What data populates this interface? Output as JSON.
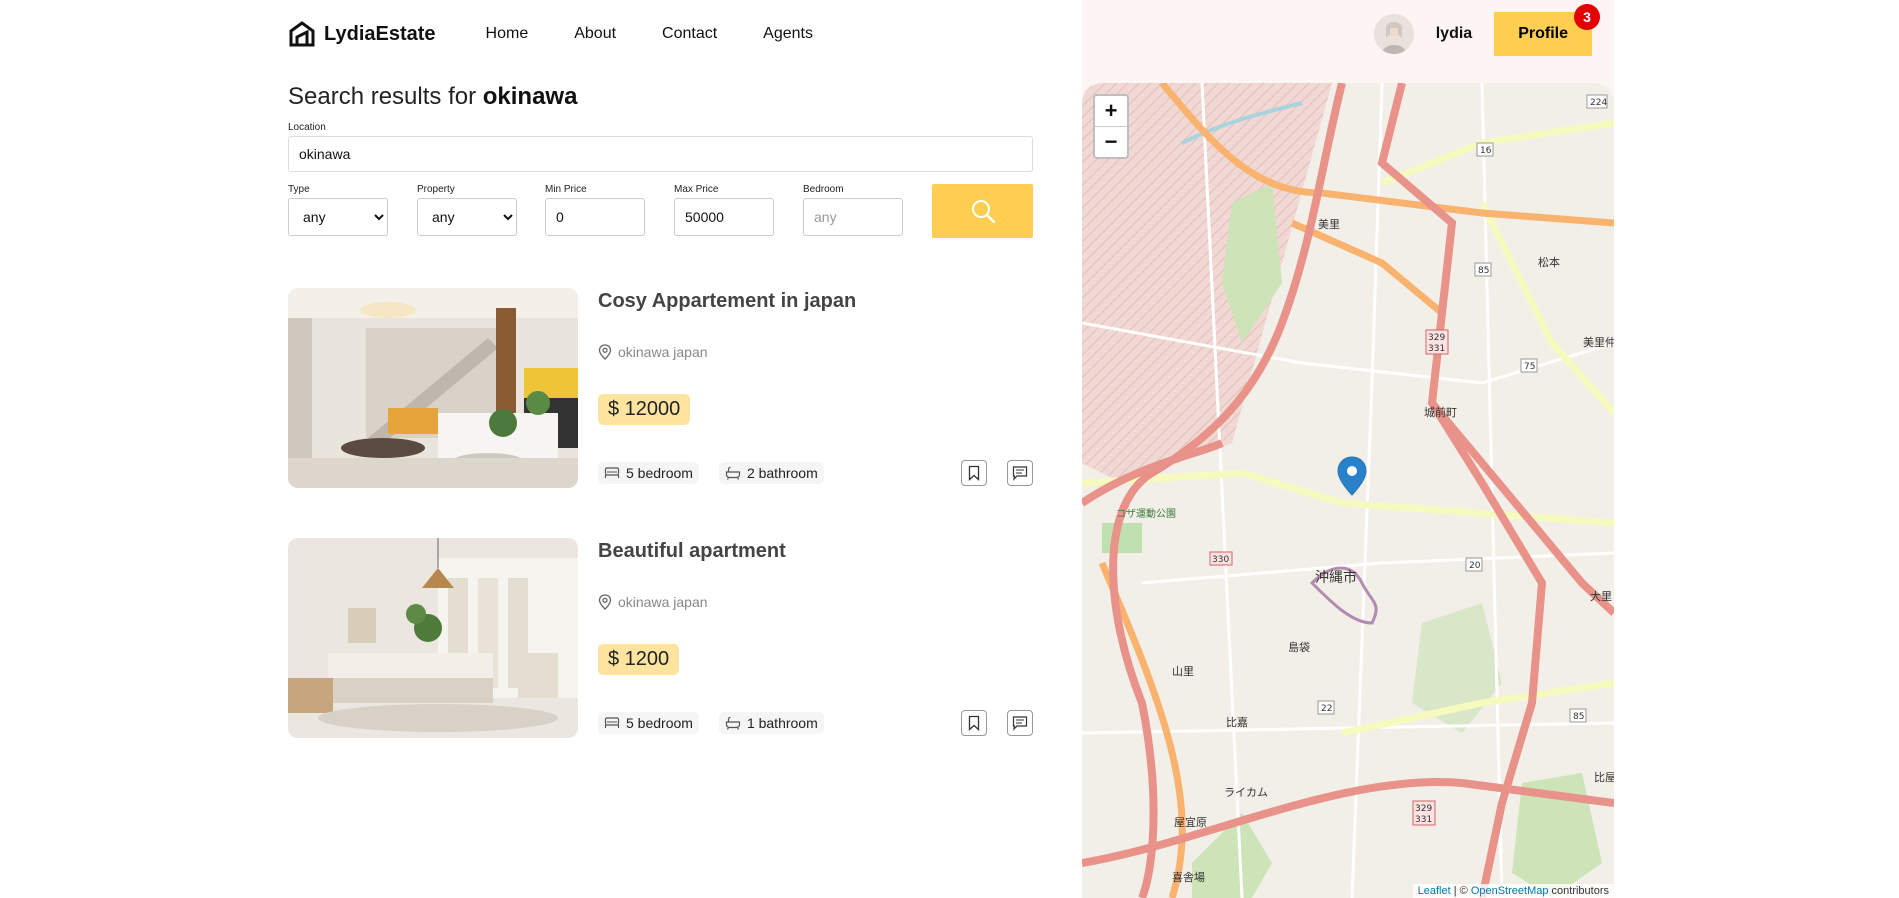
{
  "nav": {
    "logo_text": "LydiaEstate",
    "links": [
      "Home",
      "About",
      "Contact",
      "Agents"
    ]
  },
  "search": {
    "title_prefix": "Search results for ",
    "title_query": "okinawa",
    "location_label": "Location",
    "location_value": "okinawa",
    "type_label": "Type",
    "type_value": "any",
    "property_label": "Property",
    "property_value": "any",
    "min_price_label": "Min Price",
    "min_price_value": "0",
    "max_price_label": "Max Price",
    "max_price_value": "50000",
    "bedroom_label": "Bedroom",
    "bedroom_placeholder": "any"
  },
  "listings": [
    {
      "title": "Cosy Appartement in japan",
      "address": "okinawa japan",
      "price": "$ 12000",
      "bedrooms": "5 bedroom",
      "bathrooms": "2 bathroom"
    },
    {
      "title": "Beautiful apartment",
      "address": "okinawa japan",
      "price": "$ 1200",
      "bedrooms": "5 bedroom",
      "bathrooms": "1 bathroom"
    }
  ],
  "user": {
    "name": "lydia",
    "profile_label": "Profile",
    "notification_count": "3"
  },
  "map": {
    "zoom_in": "+",
    "zoom_out": "−",
    "attribution_leaflet": "Leaflet",
    "attribution_sep": " | © ",
    "attribution_osm": "OpenStreetMap",
    "attribution_suffix": " contributors",
    "labels": [
      "沖縄市",
      "美里",
      "城前町",
      "松本",
      "美里仲",
      "コザ運動公園",
      "島袋",
      "山里",
      "比嘉",
      "ライカム",
      "屋宜原",
      "喜舎場",
      "大里",
      "比屋"
    ],
    "route_numbers": [
      "224",
      "16",
      "85",
      "75",
      "329",
      "331",
      "330",
      "20",
      "22",
      "85",
      "329",
      "331"
    ]
  },
  "colors": {
    "accent": "#fece51",
    "badge": "#e30000",
    "right_bg": "#fcf5f3"
  }
}
